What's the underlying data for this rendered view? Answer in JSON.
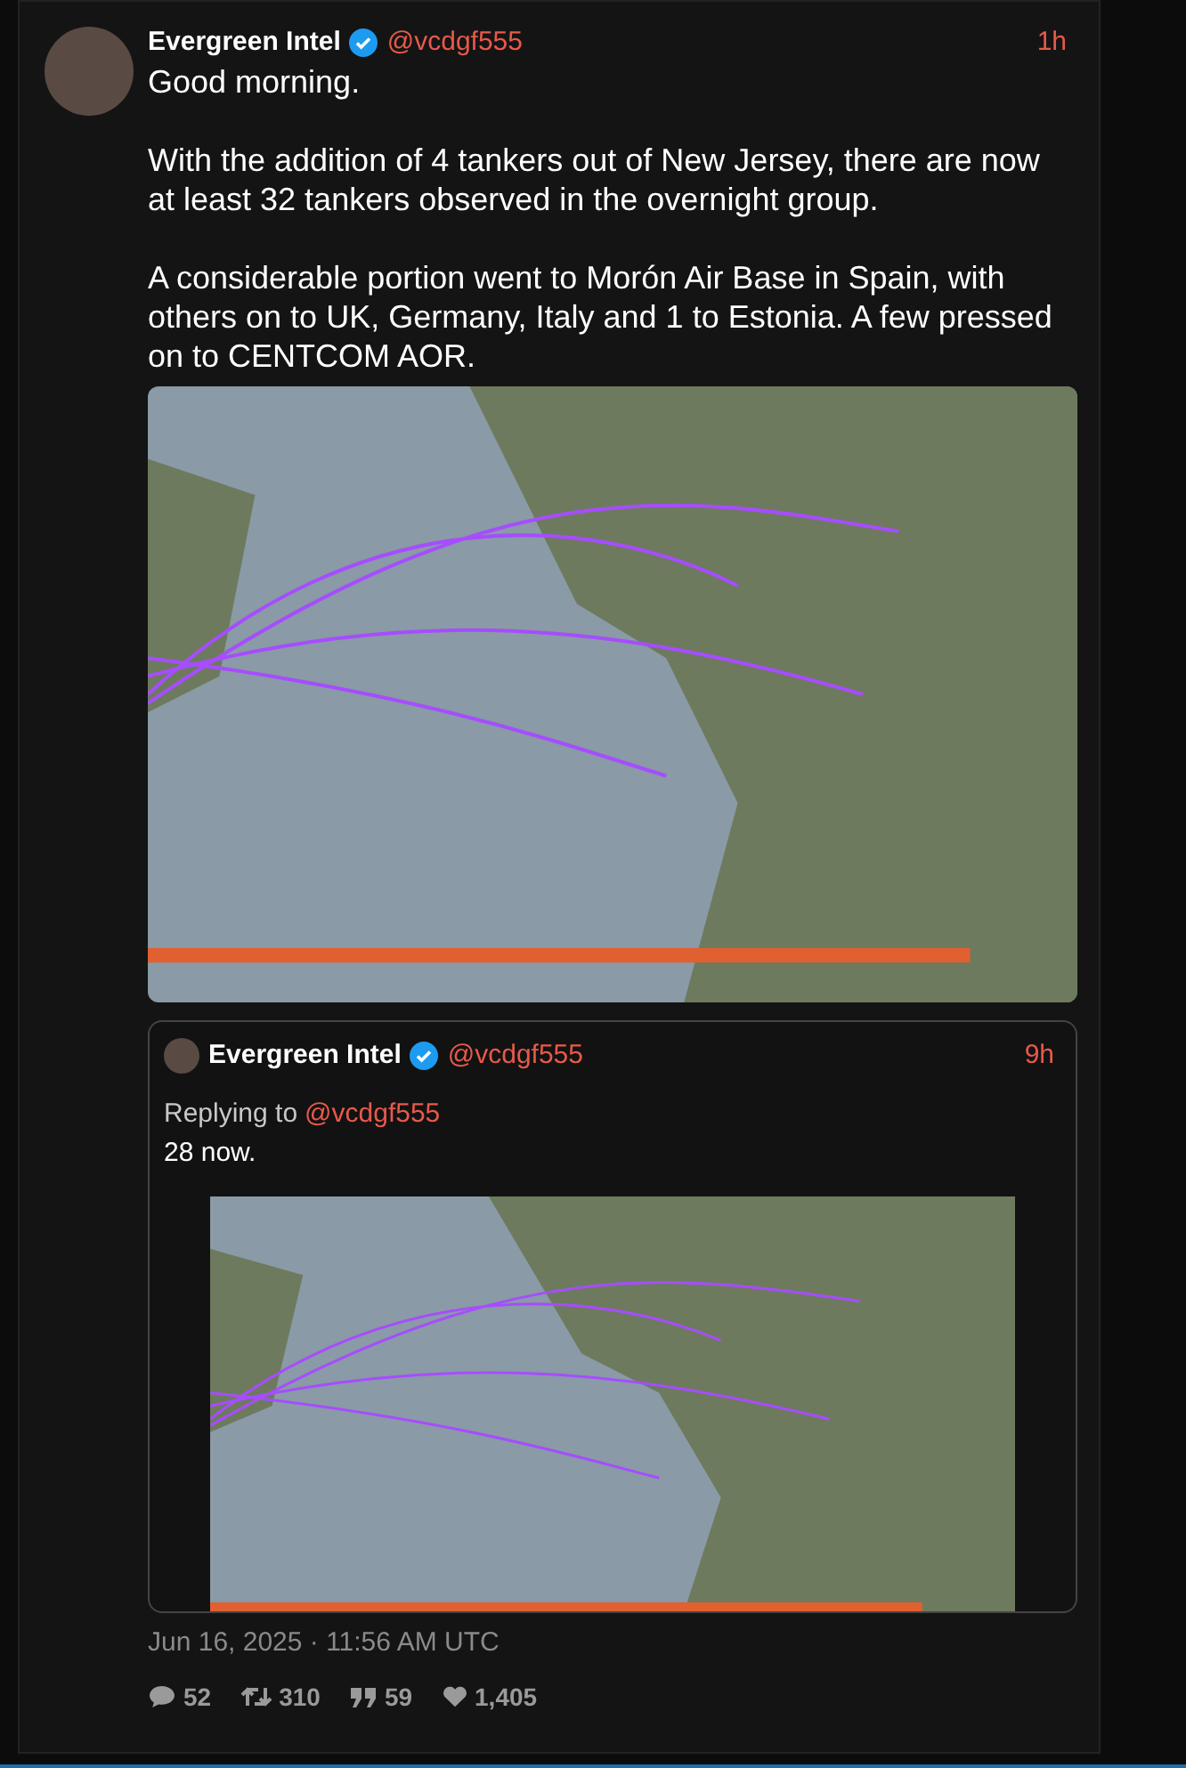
{
  "tweet": {
    "author": "Evergreen Intel",
    "verified": true,
    "handle": "@vcdgf555",
    "time": "1h",
    "paragraphs": [
      "Good morning.",
      "With the addition of 4 tankers out of New Jersey, there are now at least 32 tankers observed in the overnight group.",
      "A considerable portion went to Morón Air Base in Spain, with others on to UK, Germany, Italy and 1 to Estonia. A few pressed on to CENTCOM AOR."
    ],
    "quoted": {
      "author": "Evergreen Intel",
      "verified": true,
      "handle": "@vcdgf555",
      "time": "9h",
      "replying_label": "Replying to",
      "replying_handle": "@vcdgf555",
      "text": "28 now."
    },
    "timestamp": "Jun 16, 2025 · 11:56 AM UTC",
    "stats": [
      {
        "kind": "reply",
        "count": "52"
      },
      {
        "kind": "retweet",
        "count": "310"
      },
      {
        "kind": "quote",
        "count": "59"
      },
      {
        "kind": "like",
        "count": "1,405"
      }
    ]
  }
}
